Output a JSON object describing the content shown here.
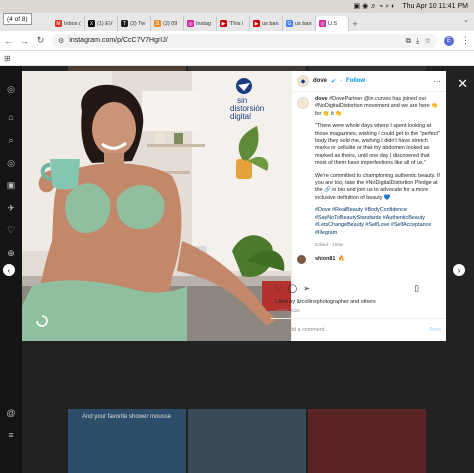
{
  "menubar": {
    "date_time": "Thu Apr 10  11:41 PM"
  },
  "window": {
    "counter": "(4 of 8)"
  },
  "tabs": [
    {
      "label": "Inbox (",
      "color": "#d93025",
      "glyph": "M"
    },
    {
      "label": "(1) EV",
      "color": "#000000",
      "glyph": "X"
    },
    {
      "label": "(2) Tw",
      "color": "#222222",
      "glyph": "T"
    },
    {
      "label": "(2) 09",
      "color": "#f08a24",
      "glyph": "S"
    },
    {
      "label": "Instag",
      "color": "#d6249f",
      "glyph": "◎"
    },
    {
      "label": "'This i",
      "color": "#cc0000",
      "glyph": "▶"
    },
    {
      "label": "us ban",
      "color": "#cc0000",
      "glyph": "▶"
    },
    {
      "label": "us ban",
      "color": "#4285f4",
      "glyph": "G"
    },
    {
      "label": "U.S",
      "color": "#d6249f",
      "glyph": "◎",
      "active": true
    }
  ],
  "address": {
    "url": "instagram.com/p/CcC7V7HgrIJ/"
  },
  "profile_initial": "E",
  "post": {
    "account": "dove",
    "follow": "Follow",
    "caption_lines": {
      "p1_a": "dove",
      "p1_b": " #DovePartner @in.curves has joined our #NoDigitalDistortion movement and we are here 👏 for 👏 it 👏",
      "p2": "\"There were whole days where I spent looking at those magazines, wishing I could get to the \"perfect\" body they sold me, wishing I didn't have stretch marks or cellulite or that my abdomen looked as marked as theirs, until one day I discovered that most of them have imperfections like all of us.\"",
      "p3": "We're committed to championing authentic beauty. If you are too, take the #NoDigitalDistortion Pledge at the 🔗 in bio and join us to advocate for a more inclusive definition of beauty 💙",
      "p4": "#Dove #RealBeauty #BodyConfidence #SayNoToBeautyStandards #AuthenticBeauty #LetsChangeBeauty #SelfLove #SelfAcceptance #Illegram"
    },
    "edited": "Edited · 158w",
    "comment_user": "shion81",
    "comment_emoji": "🔥",
    "likes": "Liked by lizcollinsphotographer and others",
    "date": "April 7, 2022",
    "add_comment_placeholder": "Add a comment...",
    "post_button": "Post",
    "photo_logo": "sin\ndistorsión\ndigital"
  },
  "background_caption": "And your favorite shower mousse"
}
